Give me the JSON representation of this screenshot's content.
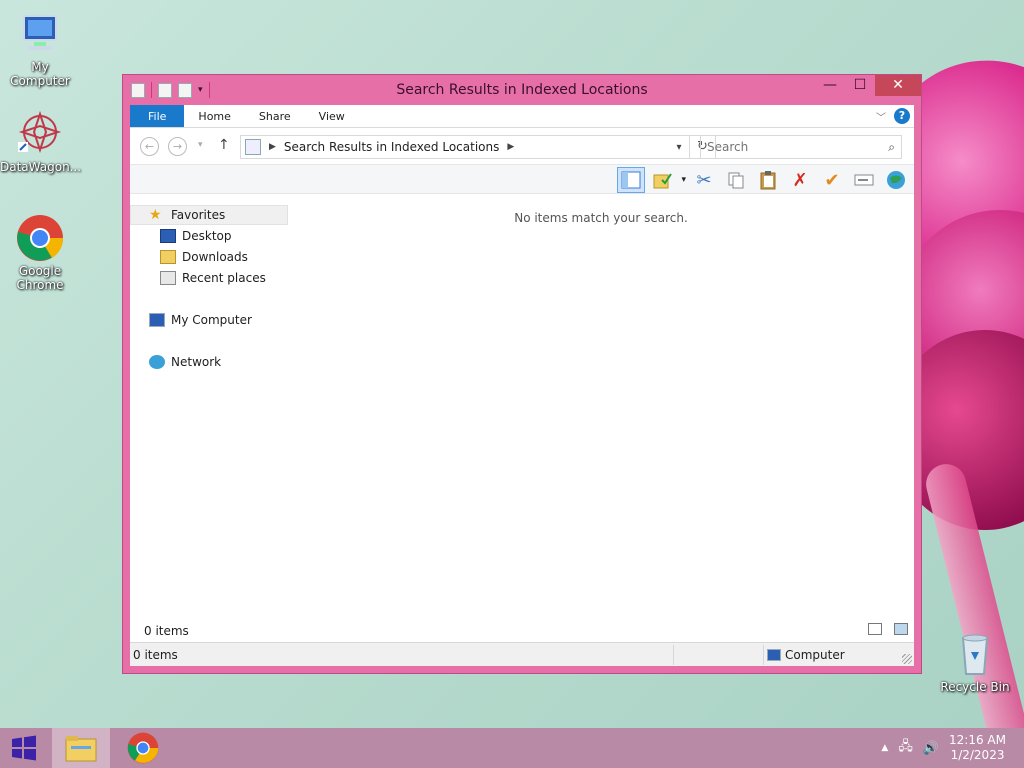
{
  "desktop": {
    "icons": [
      {
        "label": "My Computer"
      },
      {
        "label": "DataWagon..."
      },
      {
        "label": "Google Chrome"
      },
      {
        "label": "Recycle Bin"
      }
    ]
  },
  "window": {
    "title": "Search Results in Indexed Locations",
    "controls": {
      "minimize": "—",
      "maximize": "☐",
      "close": "✕"
    },
    "ribbon": {
      "tabs": [
        "File",
        "Home",
        "Share",
        "View"
      ]
    },
    "address": {
      "path": "Search Results in Indexed Locations"
    },
    "search": {
      "placeholder": "Search"
    },
    "nav": {
      "favorites": "Favorites",
      "items": [
        "Desktop",
        "Downloads",
        "Recent places"
      ],
      "computer": "My Computer",
      "network": "Network"
    },
    "content": {
      "empty_message": "No items match your search."
    },
    "info": {
      "count": "0 items"
    },
    "status": {
      "count": "0 items",
      "location": "Computer"
    }
  },
  "taskbar": {
    "clock": {
      "time": "12:16 AM",
      "date": "1/2/2023"
    }
  },
  "colors": {
    "window_frame": "#e76fa8",
    "file_tab": "#1979ca",
    "close_button": "#c7475a"
  }
}
